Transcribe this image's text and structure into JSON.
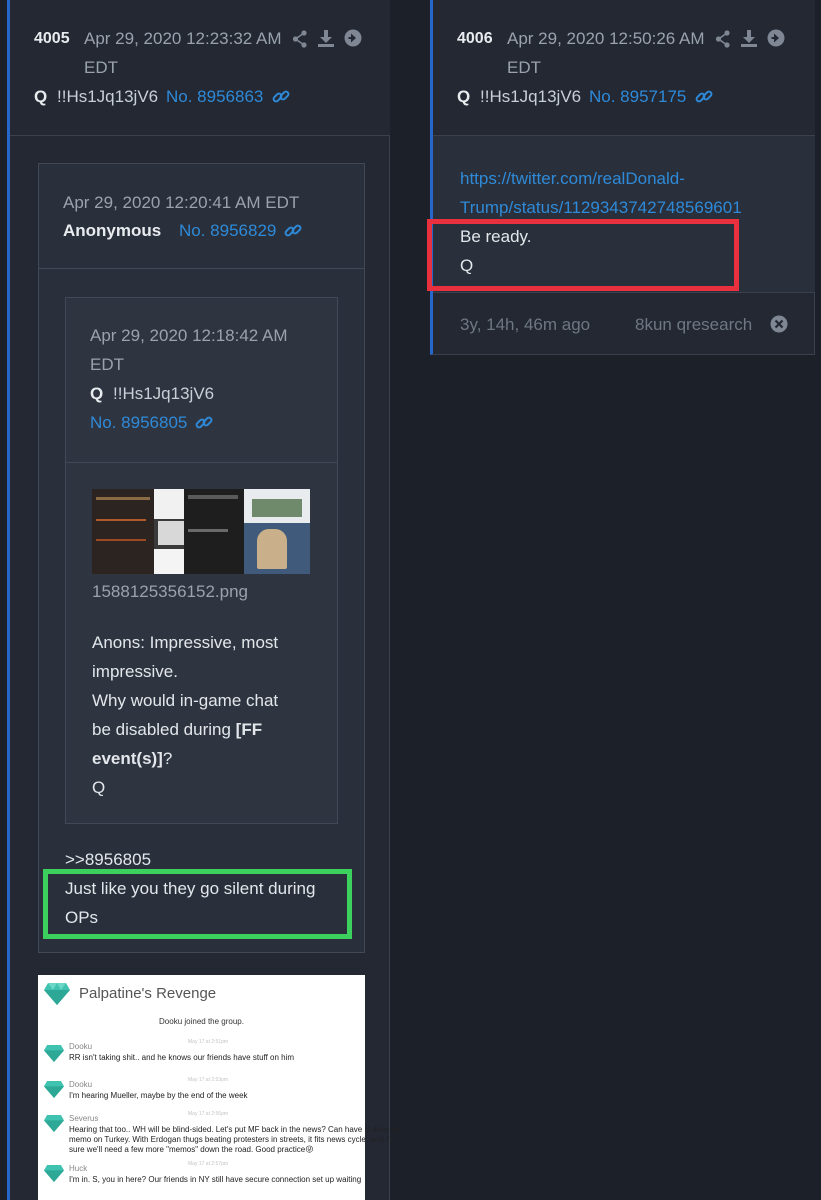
{
  "post_4005": {
    "num": "4005",
    "date_line1": "Apr 29, 2020 12:23:32 AM",
    "date_line2": "EDT",
    "author": "Q",
    "trip": "!!Hs1Jq13jV6",
    "post_no": "No. 8956863",
    "quoted": {
      "date": "Apr 29, 2020 12:20:41 AM EDT",
      "author": "Anonymous",
      "post_no": "No. 8956829",
      "nested": {
        "date_line1": "Apr 29, 2020 12:18:42 AM",
        "date_line2": "EDT",
        "author": "Q",
        "trip": "!!Hs1Jq13jV6",
        "post_no": "No. 8956805",
        "filename": "1588125356152.png",
        "text_lines": [
          "Anons: Impressive, most",
          "impressive.",
          "Why would in-game chat",
          "be disabled during "
        ],
        "bold_a": "[FF",
        "bold_b": "event(s)]",
        "after_bold": "?",
        "signoff": "Q"
      },
      "reply_ref": ">>8956805",
      "reply_line1": "Just like you they go silent during",
      "reply_line2": "OPs"
    },
    "chat": {
      "title": "Palpatine's Revenge",
      "system_msg": "Dooku joined the group.",
      "messages": [
        {
          "name": "Dooku",
          "ts": "May 17 at 2:51pm",
          "lines": [
            "RR isn't taking shit.. and he knows our friends have stuff on him"
          ]
        },
        {
          "name": "Dooku",
          "ts": "May 17 at 2:53pm",
          "lines": [
            "I'm hearing Mueller, maybe by the end of the week"
          ]
        },
        {
          "name": "Severus",
          "ts": "May 17 at 2:56pm",
          "lines": [
            "Hearing that too.. WH will be blind-sided. Let's put MF back in the news? Can have S draw up",
            "memo on Turkey. With Erdogan thugs beating protesters in streets, it fits news cycle, and I'm",
            "sure we'll need a few more \"memos\" down the road. Good practice😜"
          ]
        },
        {
          "name": "Huck",
          "ts": "May 17 at 2:57pm",
          "lines": [
            "I'm in. S, you in here? Our friends in NY still have secure connection set up waiting"
          ]
        }
      ]
    }
  },
  "post_4006": {
    "num": "4006",
    "date_line1": "Apr 29, 2020 12:50:26 AM",
    "date_line2": "EDT",
    "author": "Q",
    "trip": "!!Hs1Jq13jV6",
    "post_no": "No. 8957175",
    "url_line1": "https://twitter.com/realDonald-",
    "url_line2": "Trump/status/1129343742748569601",
    "text_line1": "Be ready.",
    "text_line2": "Q",
    "age": "3y, 14h, 46m ago",
    "source": "8kun qresearch"
  },
  "colors": {
    "accent_blue": "#2667c9",
    "link_blue": "#2e8ad8",
    "highlight_red": "#e8303f",
    "highlight_green": "#3bd15c",
    "chat_teal": "#3fc2b0"
  }
}
